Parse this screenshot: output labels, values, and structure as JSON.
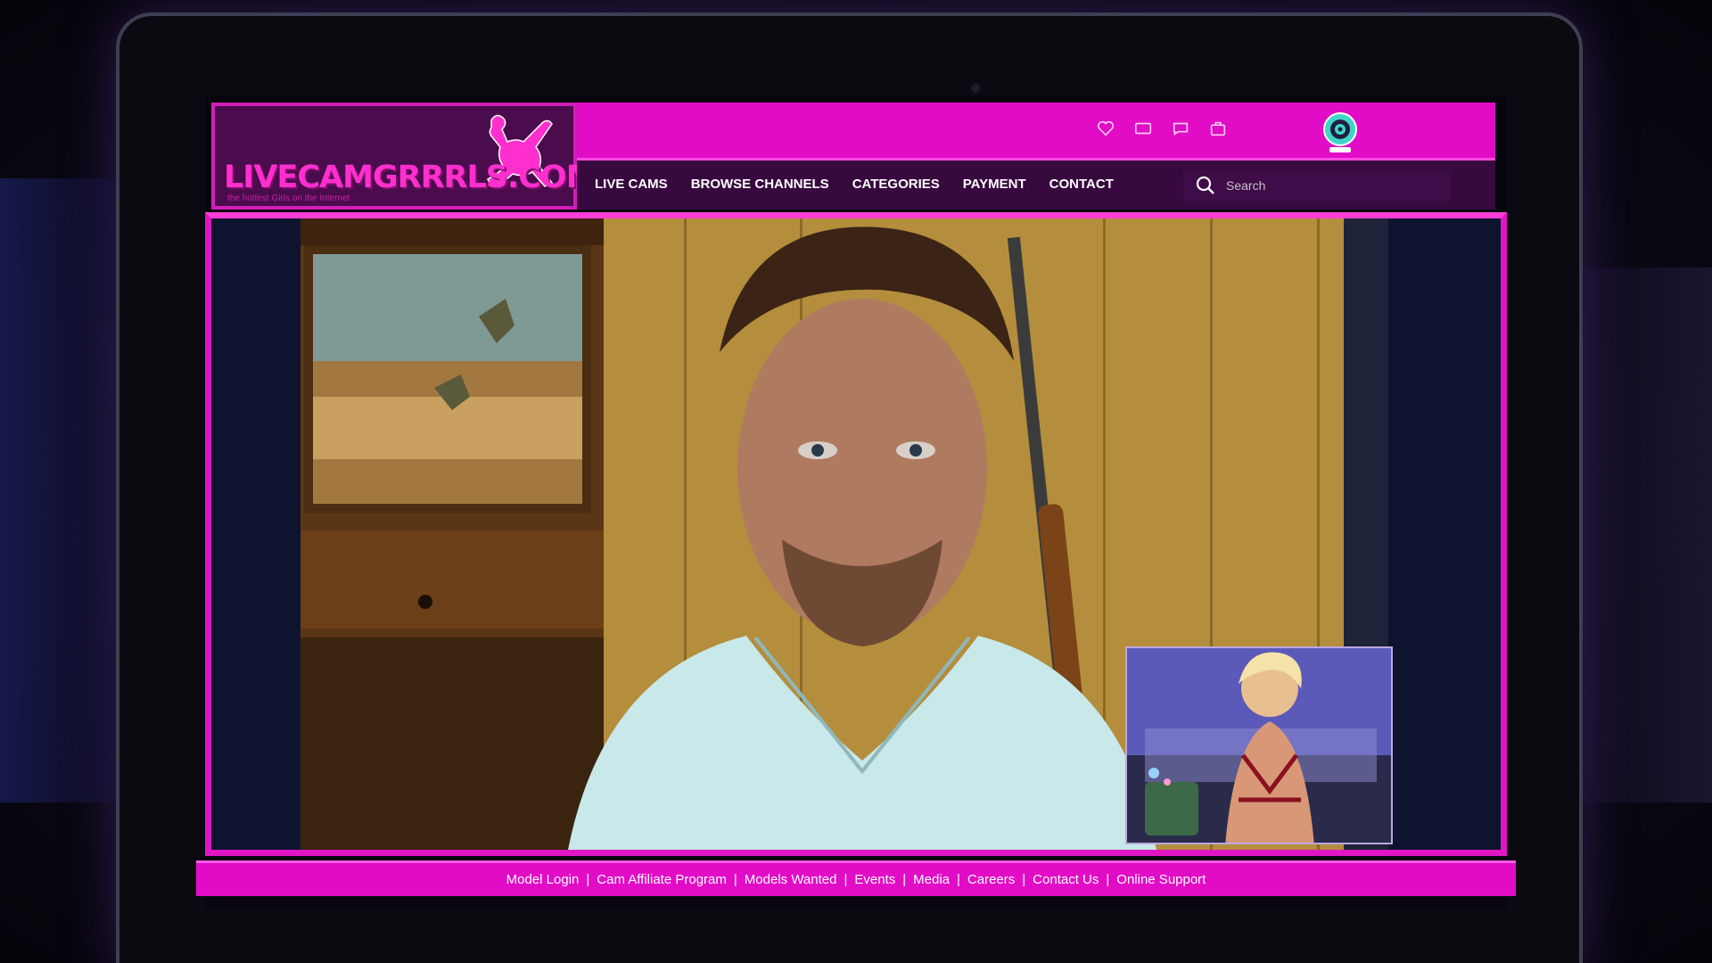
{
  "site": {
    "logo_text": "LIVECAMGRRRLS.COM",
    "logo_tagline": "the hottest Girls on the Internet"
  },
  "topbar": {
    "icons": [
      "heart-icon",
      "mail-icon",
      "chat-icon",
      "bag-icon"
    ],
    "webcam_icon": "webcam-icon"
  },
  "nav": {
    "items": [
      "LIVE CAMS",
      "BROWSE CHANNELS",
      "CATEGORIES",
      "PAYMENT",
      "CONTACT"
    ]
  },
  "search": {
    "placeholder": "Search"
  },
  "footer": {
    "links": [
      "Model Login",
      "Cam Affiliate Program",
      "Models Wanted",
      "Events",
      "Media",
      "Careers",
      "Contact Us",
      "Online Support"
    ],
    "separator": "|"
  },
  "colors": {
    "brand_pink": "#e20bc6",
    "nav_bg": "#38093f",
    "logo_pink": "#ff2fcf",
    "webcam_teal": "#3fd6c8"
  }
}
